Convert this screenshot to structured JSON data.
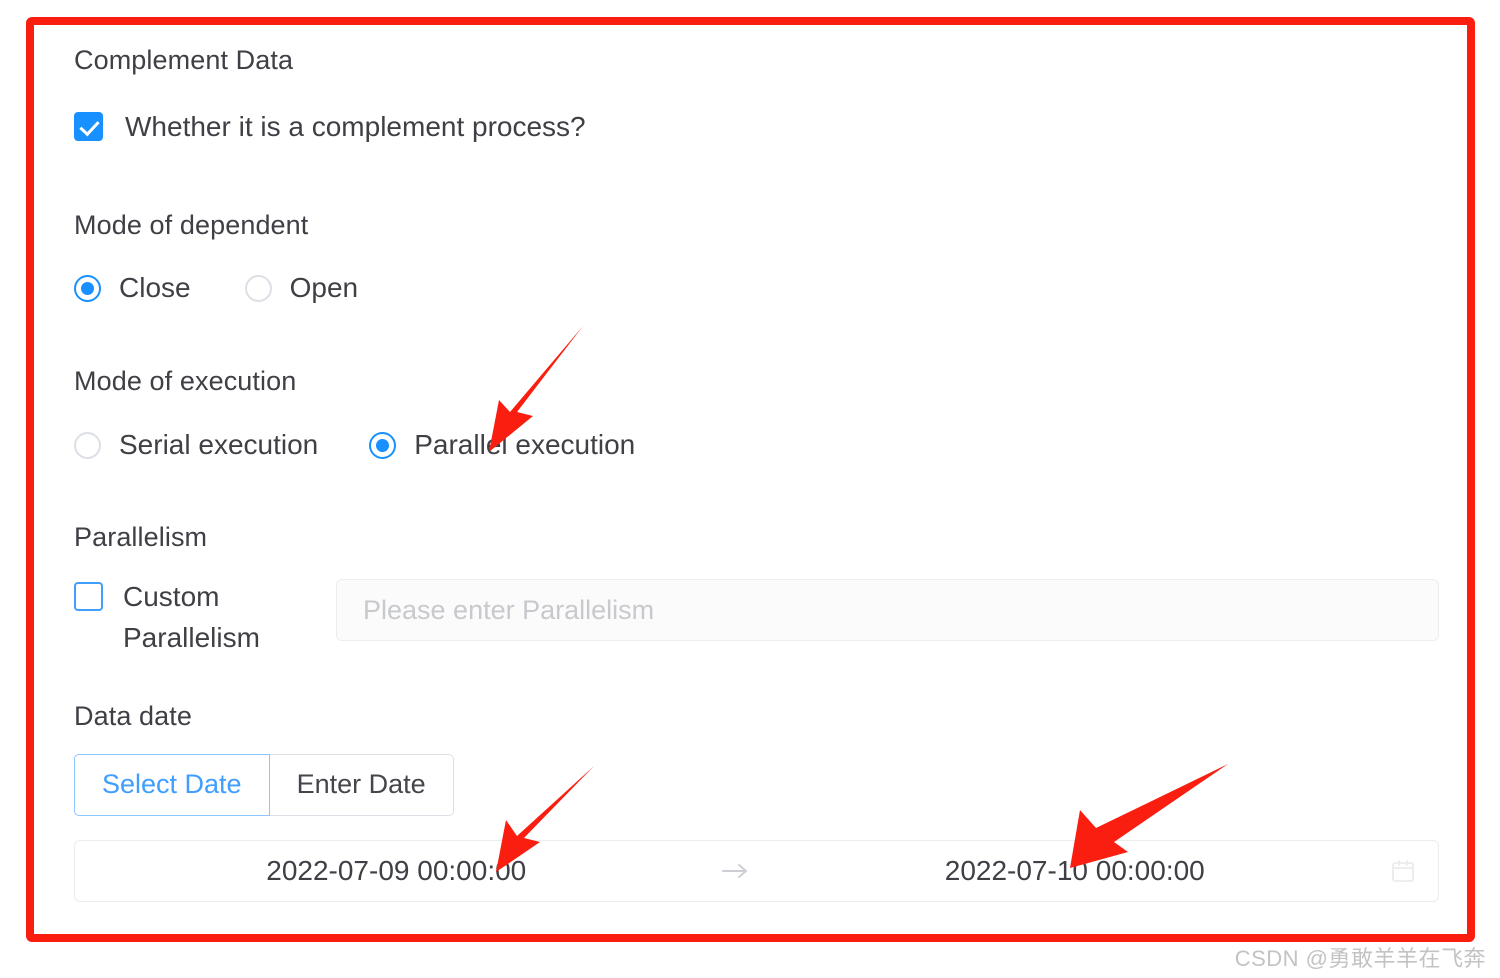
{
  "panel": {
    "title": "Complement Data",
    "complement_checkbox": {
      "label": "Whether it is a complement process?",
      "checked": true
    },
    "dependent": {
      "label": "Mode of dependent",
      "options": [
        {
          "label": "Close",
          "selected": true
        },
        {
          "label": "Open",
          "selected": false
        }
      ]
    },
    "execution": {
      "label": "Mode of execution",
      "options": [
        {
          "label": "Serial execution",
          "selected": false
        },
        {
          "label": "Parallel execution",
          "selected": true
        }
      ]
    },
    "parallelism": {
      "label": "Parallelism",
      "custom_checkbox": {
        "label": "Custom Parallelism",
        "checked": false
      },
      "input_placeholder": "Please enter Parallelism",
      "input_value": ""
    },
    "data_date": {
      "label": "Data date",
      "tabs": [
        {
          "label": "Select Date",
          "active": true
        },
        {
          "label": "Enter Date",
          "active": false
        }
      ],
      "range": {
        "start": "2022-07-09 00:00:00",
        "separator": "→",
        "end": "2022-07-10 00:00:00",
        "calendar_icon": "calendar-icon"
      }
    }
  },
  "annotations": {
    "color": "#fa1e10",
    "highlight_box_color": "#fa1e10",
    "arrows": [
      {
        "name": "arrow-to-parallel-execution"
      },
      {
        "name": "arrow-to-start-date"
      },
      {
        "name": "arrow-to-end-date"
      }
    ]
  },
  "watermark": {
    "text": "CSDN @勇敢羊羊在飞奔"
  },
  "colors": {
    "accent_blue": "#1890ff",
    "link_blue": "#409eff",
    "text": "#3f3f46",
    "placeholder": "#c7c9cd",
    "border": "#dcdfe6",
    "annotation_red": "#fa1e10"
  }
}
